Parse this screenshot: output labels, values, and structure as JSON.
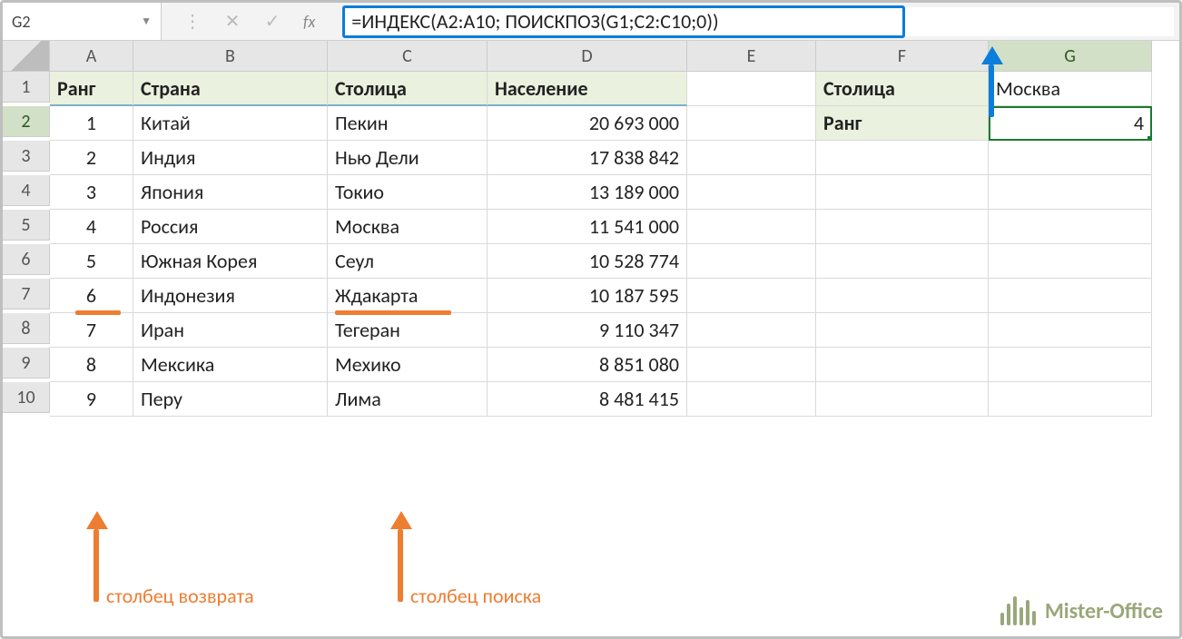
{
  "name_box": "G2",
  "formula": "=ИНДЕКС(A2:A10; ПОИСКПОЗ(G1;C2:C10;0))",
  "columns": [
    "A",
    "B",
    "C",
    "D",
    "E",
    "F",
    "G"
  ],
  "row_numbers": [
    "1",
    "2",
    "3",
    "4",
    "5",
    "6",
    "7",
    "8",
    "9",
    "10"
  ],
  "headers": {
    "rank": "Ранг",
    "country": "Страна",
    "capital": "Столица",
    "population": "Население"
  },
  "lookup": {
    "capital_label": "Столица",
    "capital_value": "Москва",
    "rank_label": "Ранг",
    "rank_value": "4"
  },
  "rows": [
    {
      "rank": "1",
      "country": "Китай",
      "capital": "Пекин",
      "population": "20 693 000"
    },
    {
      "rank": "2",
      "country": "Индия",
      "capital": "Нью Дели",
      "population": "17 838 842"
    },
    {
      "rank": "3",
      "country": "Япония",
      "capital": "Токио",
      "population": "13 189 000"
    },
    {
      "rank": "4",
      "country": "Россия",
      "capital": "Москва",
      "population": "11 541 000"
    },
    {
      "rank": "5",
      "country": "Южная Корея",
      "capital": "Сеул",
      "population": "10 528 774"
    },
    {
      "rank": "6",
      "country": "Индонезия",
      "capital": "Ждакарта",
      "population": "10 187 595"
    },
    {
      "rank": "7",
      "country": "Иран",
      "capital": "Тегеран",
      "population": "9 110 347"
    },
    {
      "rank": "8",
      "country": "Мексика",
      "capital": "Мехико",
      "population": "8 851 080"
    },
    {
      "rank": "9",
      "country": "Перу",
      "capital": "Лима",
      "population": "8 481 415"
    }
  ],
  "annotations": {
    "return_col": "столбец возврата",
    "search_col": "столбец поиска"
  },
  "brand": "Mister-Office"
}
